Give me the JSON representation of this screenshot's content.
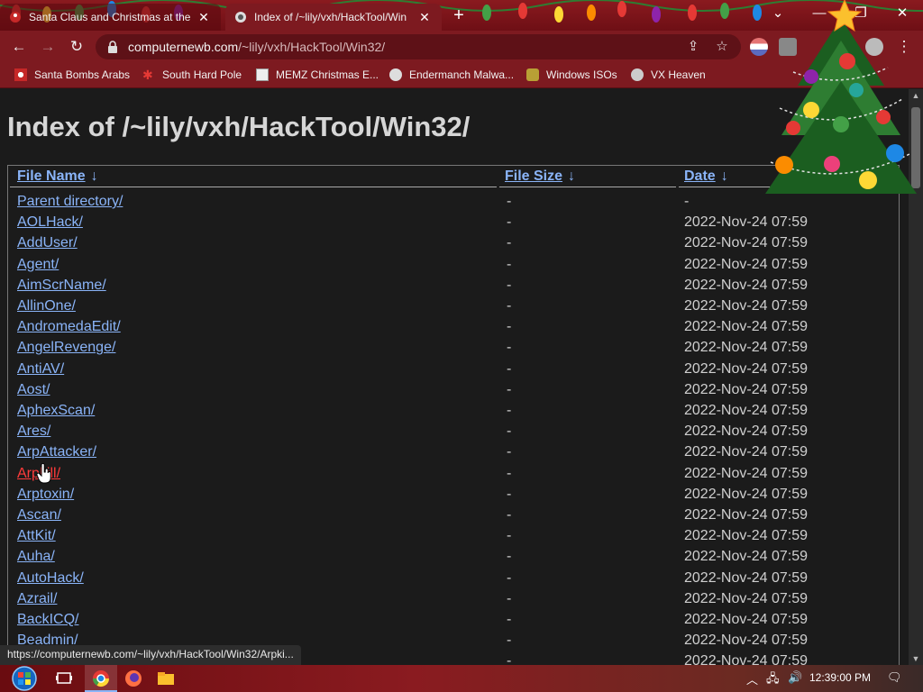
{
  "browser": {
    "tabs": [
      {
        "title": "Santa Claus and Christmas at the",
        "active": false
      },
      {
        "title": "Index of /~lily/vxh/HackTool/Win",
        "active": true
      }
    ],
    "new_tab_label": "+",
    "window_controls": {
      "dropdown": "⌄",
      "minimize": "—",
      "restore": "❐",
      "close": "✕"
    },
    "url_domain": "computernewb.com",
    "url_path": "/~lily/vxh/HackTool/Win32/",
    "bookmarks": [
      "Santa Bombs Arabs",
      "South Hard Pole",
      "MEMZ Christmas E...",
      "Endermanch Malwa...",
      "Windows ISOs",
      "VX Heaven"
    ]
  },
  "page": {
    "heading": "Index of /~lily/vxh/HackTool/Win32/",
    "columns": {
      "name": "File Name",
      "size": "File Size",
      "date": "Date",
      "sort_arrow": "↓"
    },
    "rows": [
      {
        "name": "Parent directory/",
        "size": "-",
        "date": "-"
      },
      {
        "name": "AOLHack/",
        "size": "-",
        "date": "2022-Nov-24 07:59"
      },
      {
        "name": "AddUser/",
        "size": "-",
        "date": "2022-Nov-24 07:59"
      },
      {
        "name": "Agent/",
        "size": "-",
        "date": "2022-Nov-24 07:59"
      },
      {
        "name": "AimScrName/",
        "size": "-",
        "date": "2022-Nov-24 07:59"
      },
      {
        "name": "AllinOne/",
        "size": "-",
        "date": "2022-Nov-24 07:59"
      },
      {
        "name": "AndromedaEdit/",
        "size": "-",
        "date": "2022-Nov-24 07:59"
      },
      {
        "name": "AngelRevenge/",
        "size": "-",
        "date": "2022-Nov-24 07:59"
      },
      {
        "name": "AntiAV/",
        "size": "-",
        "date": "2022-Nov-24 07:59"
      },
      {
        "name": "Aost/",
        "size": "-",
        "date": "2022-Nov-24 07:59"
      },
      {
        "name": "AphexScan/",
        "size": "-",
        "date": "2022-Nov-24 07:59"
      },
      {
        "name": "Ares/",
        "size": "-",
        "date": "2022-Nov-24 07:59"
      },
      {
        "name": "ArpAttacker/",
        "size": "-",
        "date": "2022-Nov-24 07:59"
      },
      {
        "name": "Arpkill/",
        "size": "-",
        "date": "2022-Nov-24 07:59",
        "hovered": true
      },
      {
        "name": "Arptoxin/",
        "size": "-",
        "date": "2022-Nov-24 07:59"
      },
      {
        "name": "Ascan/",
        "size": "-",
        "date": "2022-Nov-24 07:59"
      },
      {
        "name": "AttKit/",
        "size": "-",
        "date": "2022-Nov-24 07:59"
      },
      {
        "name": "Auha/",
        "size": "-",
        "date": "2022-Nov-24 07:59"
      },
      {
        "name": "AutoHack/",
        "size": "-",
        "date": "2022-Nov-24 07:59"
      },
      {
        "name": "Azrail/",
        "size": "-",
        "date": "2022-Nov-24 07:59"
      },
      {
        "name": "BackICQ/",
        "size": "-",
        "date": "2022-Nov-24 07:59"
      },
      {
        "name": "Beadmin/",
        "size": "-",
        "date": "2022-Nov-24 07:59"
      },
      {
        "name": "",
        "size": "-",
        "date": "2022-Nov-24 07:59"
      }
    ]
  },
  "status_url": "https://computernewb.com/~lily/vxh/HackTool/Win32/Arpki...",
  "taskbar": {
    "clock": "12:39:00 PM",
    "icons": [
      "start-orb-icon",
      "task-view-icon",
      "chrome-icon",
      "firefox-icon",
      "file-explorer-icon"
    ],
    "tray_icons": [
      "chevron-up-icon",
      "network-icon",
      "volume-icon",
      "notification-icon"
    ]
  },
  "colors": {
    "theme": "#7d1a20",
    "link": "#8ab4f8",
    "link_hover": "#ff3b3b",
    "page_bg": "#1b1b1b"
  }
}
